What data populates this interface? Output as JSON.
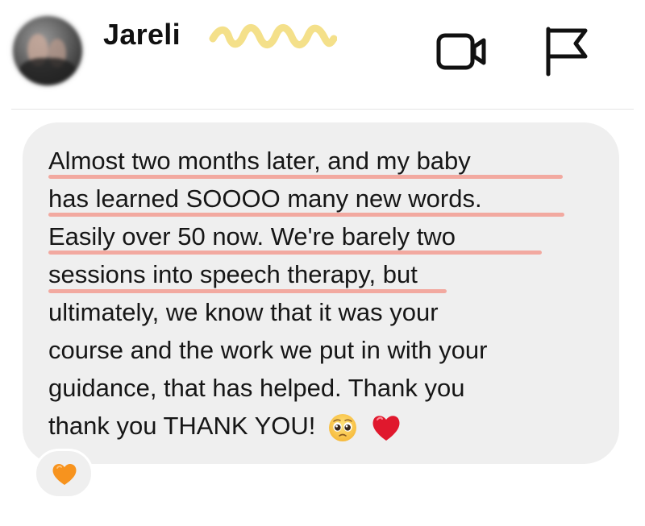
{
  "header": {
    "contact_name": "Jareli",
    "avatar_icon": "avatar-icon",
    "decoration": "squiggle-doodle",
    "video_call_icon": "video-camera-icon",
    "report_icon": "flag-icon"
  },
  "message": {
    "lines": [
      "Almost two months later, and my baby",
      "has learned SOOOO many new words.",
      "Easily over 50 now. We're barely two",
      "sessions into speech therapy, but",
      "ultimately, we know that it was your",
      "course and the work we put in with your",
      "guidance, that has helped. Thank you",
      "thank you THANK YOU!"
    ],
    "trailing_emojis": [
      "pleading-face-emoji",
      "red-heart-emoji"
    ],
    "highlight_color": "#f2a9a0"
  },
  "reaction": {
    "emoji": "orange-heart-emoji"
  },
  "colors": {
    "bubble": "#efefef",
    "squiggle": "#f4e08a",
    "text": "#161616"
  }
}
